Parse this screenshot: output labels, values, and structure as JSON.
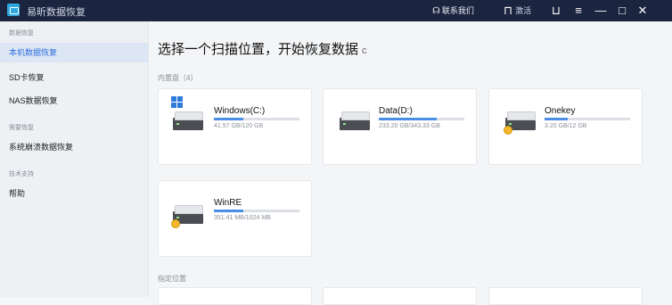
{
  "app": {
    "title": "易昕数据恢复"
  },
  "titlebar": {
    "contact": "联系我们",
    "activate": "激活",
    "buttons": [
      "feedback-icon",
      "menu-icon",
      "minimize-icon",
      "maximize-icon",
      "close-icon"
    ]
  },
  "sidebar": {
    "sections": [
      {
        "label": "数据恢复",
        "items": [
          {
            "label": "本机数据恢复",
            "active": true
          },
          {
            "label": "SD卡恢复",
            "active": false
          },
          {
            "label": "NAS数据恢复",
            "active": false
          }
        ]
      },
      {
        "label": "需要恢复",
        "items": [
          {
            "label": "系统崩溃数据恢复",
            "active": false
          }
        ]
      },
      {
        "label": "技术支持",
        "items": [
          {
            "label": "帮助",
            "active": false
          }
        ]
      }
    ]
  },
  "main": {
    "heading": "选择一个扫描位置，开始恢复数据",
    "refresh_glyph": "c",
    "internal_label": "内置盘（4）",
    "specified_label": "指定位置",
    "drives": [
      {
        "name": "Windows(C:)",
        "size": "41.57 GB/120 GB",
        "used": 0.346,
        "icon": "windows-drive-icon"
      },
      {
        "name": "Data(D:)",
        "size": "233.20 GB/343.33 GB",
        "used": 0.679,
        "icon": "hard-drive-icon"
      },
      {
        "name": "Onekey",
        "size": "3.20 GB/12 GB",
        "used": 0.267,
        "icon": "locked-drive-icon"
      },
      {
        "name": "WinRE",
        "size": "351.41 MB/1024 MB",
        "used": 0.343,
        "icon": "locked-drive-icon"
      }
    ]
  },
  "colors": {
    "titlebar": "#1c2540",
    "accent": "#2f6fdd",
    "bar_fill": "#4a8ee6"
  }
}
